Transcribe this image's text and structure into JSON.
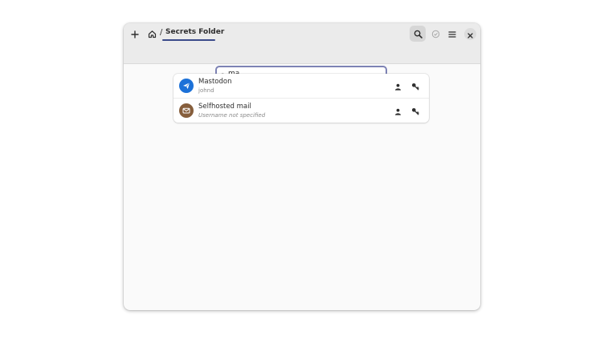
{
  "header": {
    "breadcrumb_separator": "/",
    "folder_title": "Secrets Folder",
    "icons": {
      "add": "plus-icon",
      "home": "home-icon",
      "search": "search-icon",
      "select": "check-circle-icon",
      "menu": "hamburger-menu-icon",
      "close": "close-icon"
    }
  },
  "search": {
    "value": "ma",
    "icons": {
      "search": "search-icon",
      "clear": "clear-backspace-icon"
    }
  },
  "items": [
    {
      "title": "Mastodon",
      "subtitle": "johnd",
      "avatar_color": "#1c71d8",
      "avatar_icon": "paper-plane-icon",
      "actions": [
        "copy-username-icon",
        "copy-password-icon"
      ]
    },
    {
      "title": "Selfhosted mail",
      "subtitle": "Username not specified",
      "avatar_color": "#865e3c",
      "avatar_icon": "mail-envelope-icon",
      "actions": [
        "copy-username-icon",
        "copy-password-icon"
      ]
    }
  ],
  "colors": {
    "accent": "#3a4a8a",
    "focus_ring": "#7d82b4"
  }
}
